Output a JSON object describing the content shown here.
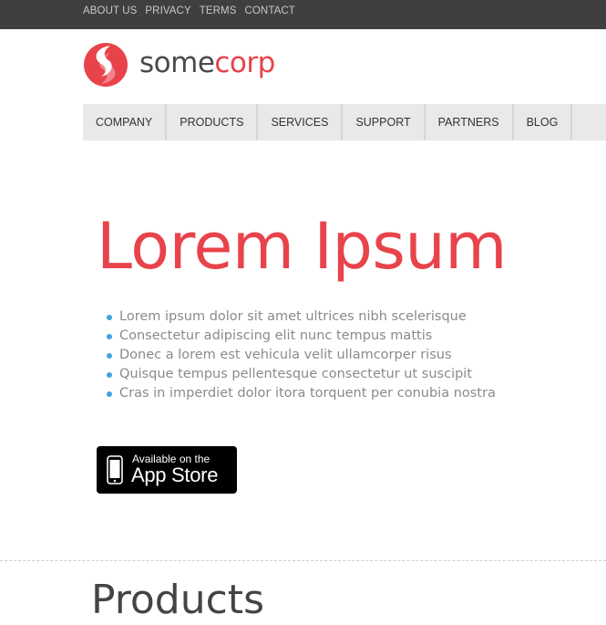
{
  "top_links": [
    "ABOUT US",
    "PRIVACY",
    "TERMS",
    "CONTACT"
  ],
  "brand": {
    "name_part1": "some",
    "name_part2": "corp",
    "colors": {
      "accent": "#e8434b",
      "dark": "#4a4a4a"
    }
  },
  "nav": [
    "COMPANY",
    "PRODUCTS",
    "SERVICES",
    "SUPPORT",
    "PARTNERS",
    "BLOG"
  ],
  "hero": {
    "title": "Lorem Ipsum",
    "features": [
      "Lorem ipsum dolor sit amet ultrices nibh scelerisque",
      "Consectetur adipiscing elit nunc tempus mattis",
      "Donec a lorem est vehicula velit ullamcorper risus",
      "Quisque tempus pellentesque consectetur ut suscipit",
      "Cras in imperdiet dolor itora torquent per conubia nostra"
    ]
  },
  "app_store_badge": {
    "line1": "Available on the",
    "line2": "App Store",
    "icon": "iphone-icon"
  },
  "sections": {
    "products_title": "Products"
  }
}
